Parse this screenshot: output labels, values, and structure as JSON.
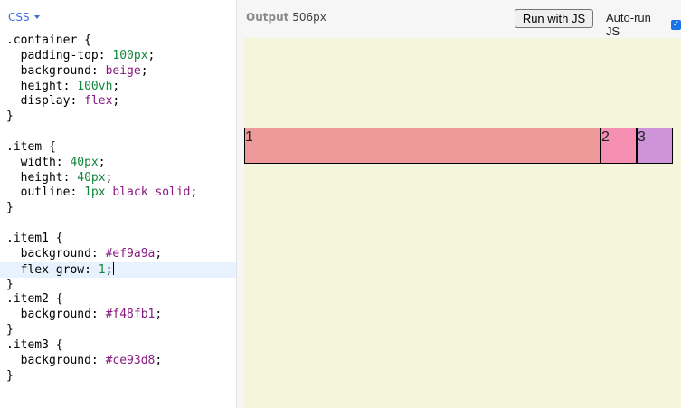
{
  "editor": {
    "language": "CSS",
    "lines": [
      [
        {
          "t": "p",
          "s": ".container {"
        }
      ],
      [
        {
          "t": "p",
          "s": "  padding-top: "
        },
        {
          "t": "n",
          "s": "100px"
        },
        {
          "t": "p",
          "s": ";"
        }
      ],
      [
        {
          "t": "p",
          "s": "  background: "
        },
        {
          "t": "v",
          "s": "beige"
        },
        {
          "t": "p",
          "s": ";"
        }
      ],
      [
        {
          "t": "p",
          "s": "  height: "
        },
        {
          "t": "n",
          "s": "100vh"
        },
        {
          "t": "p",
          "s": ";"
        }
      ],
      [
        {
          "t": "p",
          "s": "  display: "
        },
        {
          "t": "v",
          "s": "flex"
        },
        {
          "t": "p",
          "s": ";"
        }
      ],
      [
        {
          "t": "p",
          "s": "}"
        }
      ],
      [],
      [
        {
          "t": "p",
          "s": ".item {"
        }
      ],
      [
        {
          "t": "p",
          "s": "  width: "
        },
        {
          "t": "n",
          "s": "40px"
        },
        {
          "t": "p",
          "s": ";"
        }
      ],
      [
        {
          "t": "p",
          "s": "  height: "
        },
        {
          "t": "n",
          "s": "40px"
        },
        {
          "t": "p",
          "s": ";"
        }
      ],
      [
        {
          "t": "p",
          "s": "  outline: "
        },
        {
          "t": "n",
          "s": "1px"
        },
        {
          "t": "p",
          "s": " "
        },
        {
          "t": "v",
          "s": "black solid"
        },
        {
          "t": "p",
          "s": ";"
        }
      ],
      [
        {
          "t": "p",
          "s": "}"
        }
      ],
      [],
      [
        {
          "t": "p",
          "s": ".item1 {"
        }
      ],
      [
        {
          "t": "p",
          "s": "  background: "
        },
        {
          "t": "v",
          "s": "#ef9a9a"
        },
        {
          "t": "p",
          "s": ";"
        }
      ],
      [
        {
          "t": "p",
          "s": "  flex-grow: "
        },
        {
          "t": "n",
          "s": "1"
        },
        {
          "t": "p",
          "s": ";"
        }
      ],
      [
        {
          "t": "p",
          "s": "}"
        }
      ],
      [
        {
          "t": "p",
          "s": ".item2 {"
        }
      ],
      [
        {
          "t": "p",
          "s": "  background: "
        },
        {
          "t": "v",
          "s": "#f48fb1"
        },
        {
          "t": "p",
          "s": ";"
        }
      ],
      [
        {
          "t": "p",
          "s": "}"
        }
      ],
      [
        {
          "t": "p",
          "s": ".item3 {"
        }
      ],
      [
        {
          "t": "p",
          "s": "  background: "
        },
        {
          "t": "v",
          "s": "#ce93d8"
        },
        {
          "t": "p",
          "s": ";"
        }
      ],
      [
        {
          "t": "p",
          "s": "}"
        }
      ]
    ],
    "active_line": 15
  },
  "output": {
    "label": "Output",
    "size": "506px",
    "run_button": "Run with JS",
    "autorun_label": "Auto-run JS",
    "autorun_checked": true,
    "items": [
      {
        "label": "1",
        "color": "#ef9a9a",
        "grow": 1
      },
      {
        "label": "2",
        "color": "#f48fb1",
        "grow": 0
      },
      {
        "label": "3",
        "color": "#ce93d8",
        "grow": 0
      }
    ]
  }
}
